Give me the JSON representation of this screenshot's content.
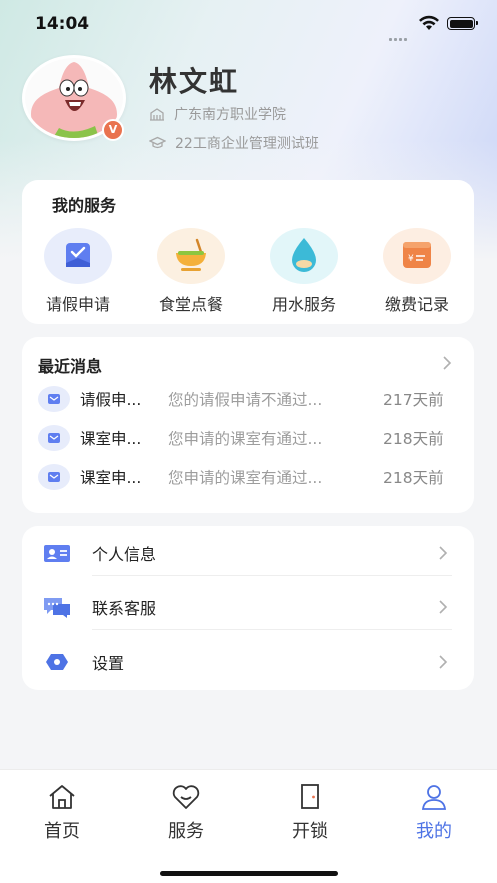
{
  "status_bar": {
    "time": "14:04"
  },
  "profile": {
    "name": "林文虹",
    "school": "广东南方职业学院",
    "class": "22工商企业管理测试班",
    "badge": "V",
    "avatar_icon": "cartoon-starfish-avatar"
  },
  "services": {
    "title": "我的服务",
    "items": [
      {
        "label": "请假申请",
        "icon": "leave-request-icon",
        "color": "#6f88f0"
      },
      {
        "label": "食堂点餐",
        "icon": "canteen-bowl-icon",
        "color": "#f0a93a"
      },
      {
        "label": "用水服务",
        "icon": "water-drop-icon",
        "color": "#36b7d6"
      },
      {
        "label": "缴费记录",
        "icon": "payment-receipt-icon",
        "color": "#ef8a4d"
      }
    ]
  },
  "messages": {
    "title": "最近消息",
    "items": [
      {
        "title": "请假申...",
        "body": "您的请假申请不通过...",
        "time": "217天前"
      },
      {
        "title": "课室申...",
        "body": "您申请的课室有通过...",
        "time": "218天前"
      },
      {
        "title": "课室申...",
        "body": "您申请的课室有通过...",
        "time": "218天前"
      }
    ]
  },
  "menu": {
    "items": [
      {
        "label": "个人信息",
        "icon": "id-card-icon"
      },
      {
        "label": "联系客服",
        "icon": "chat-bubbles-icon"
      },
      {
        "label": "设置",
        "icon": "settings-hexagon-icon"
      }
    ]
  },
  "tabbar": {
    "items": [
      {
        "label": "首页",
        "icon": "home-icon",
        "active": false
      },
      {
        "label": "服务",
        "icon": "heart-icon",
        "active": false
      },
      {
        "label": "开锁",
        "icon": "door-icon",
        "active": false
      },
      {
        "label": "我的",
        "icon": "user-icon",
        "active": true
      }
    ]
  },
  "colors": {
    "accent": "#4e73e5",
    "badge": "#e9734f"
  }
}
